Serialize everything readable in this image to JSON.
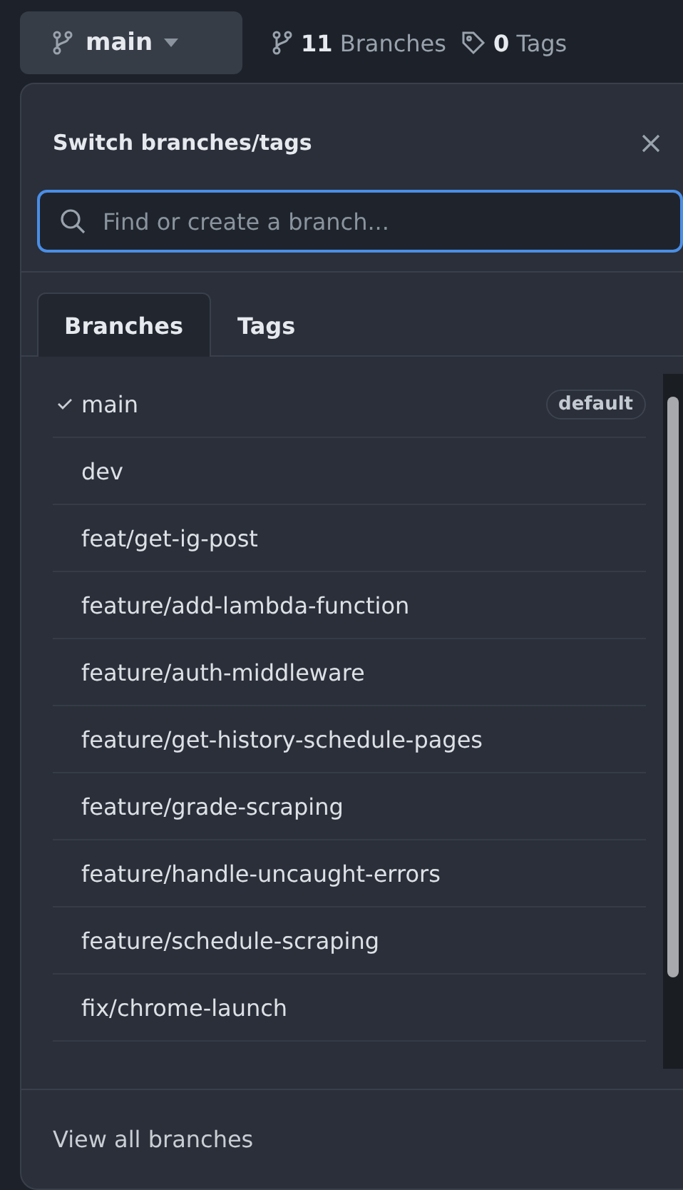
{
  "branch_button": {
    "label": "main"
  },
  "counts": [
    {
      "kind": "branch",
      "text": "**11** Branches"
    },
    {
      "kind": "tag",
      "text": "**0** Tags"
    }
  ],
  "popover": {
    "title": "Switch branches/tags",
    "search": {
      "placeholder": "Find or create a branch..."
    },
    "tabs": [
      {
        "label": "Branches",
        "selected": true
      },
      {
        "label": "Tags",
        "selected": false
      }
    ],
    "branches": [
      {
        "name": "main",
        "selected": true,
        "badge": "default"
      },
      {
        "name": "dev",
        "selected": false
      },
      {
        "name": "feat/get-ig-post",
        "selected": false
      },
      {
        "name": "feature/add-lambda-function",
        "selected": false
      },
      {
        "name": "feature/auth-middleware",
        "selected": false
      },
      {
        "name": "feature/get-history-schedule-pages",
        "selected": false
      },
      {
        "name": "feature/grade-scraping",
        "selected": false
      },
      {
        "name": "feature/handle-uncaught-errors",
        "selected": false
      },
      {
        "name": "feature/schedule-scraping",
        "selected": false
      },
      {
        "name": "fix/chrome-launch",
        "selected": false
      }
    ],
    "footer_link": "View all branches"
  }
}
